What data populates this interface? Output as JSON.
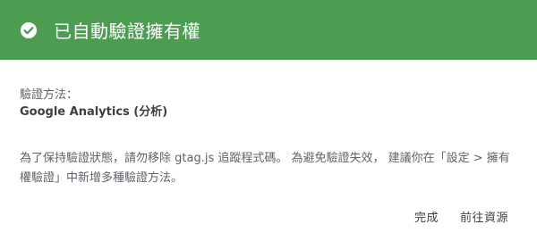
{
  "header": {
    "title": "已自動驗證擁有權",
    "icon": "check-circle-icon",
    "background": "#4c9c52"
  },
  "method": {
    "label": "驗證方法：",
    "value": "Google Analytics (分析)"
  },
  "note": "為了保持驗證狀態，請勿移除 gtag.js 追蹤程式碼。 為避免驗證失效， 建議你在「設定 > 擁有權驗證」中新增多種驗證方法。",
  "actions": {
    "done_label": "完成",
    "go_label": "前往資源"
  }
}
